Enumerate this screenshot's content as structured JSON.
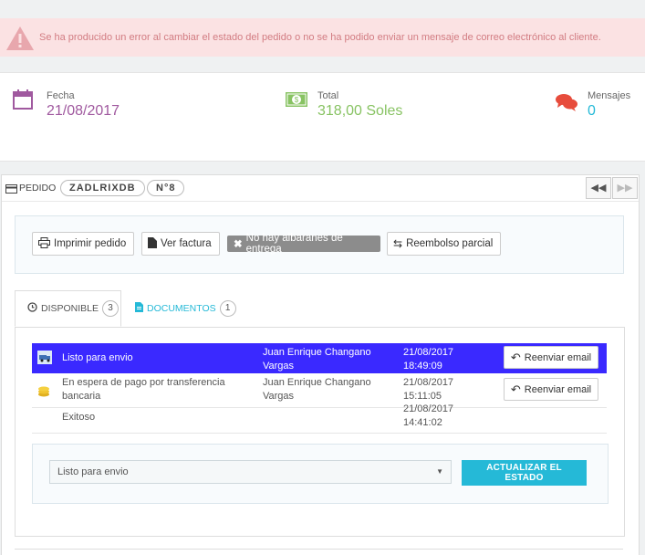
{
  "alert": {
    "message": "Se ha producido un error al cambiar el estado del pedido o no se ha podido enviar un mensaje de correo electrónico al cliente.",
    "icon": "warning-icon"
  },
  "kpis": {
    "fecha": {
      "label": "Fecha",
      "value": "21/08/2017",
      "color": "#a0599f",
      "icon": "calendar-icon"
    },
    "total": {
      "label": "Total",
      "value": "318,00 Soles",
      "color": "#88c363",
      "icon": "money-icon"
    },
    "mensajes": {
      "label": "Mensajes",
      "value": "0",
      "color": "#25b9d7",
      "icon": "chat-icon"
    }
  },
  "order": {
    "label": "PEDIDO",
    "reference": "ZADLRIXDB",
    "number": "N°8",
    "nav_prev_icon": "backward-icon",
    "nav_next_icon": "forward-icon"
  },
  "actions": {
    "print": "Imprimir pedido",
    "invoice": "Ver factura",
    "no_delivery": "No hay albaranes de entrega",
    "refund": "Reembolso parcial"
  },
  "tabs": {
    "disponible": {
      "label": "DISPONIBLE",
      "count": "3"
    },
    "documentos": {
      "label": "DOCUMENTOS",
      "count": "1"
    }
  },
  "history": [
    {
      "state": "Listo para envio",
      "employee": "Juan Enrique Changano Vargas",
      "date": "21/08/2017",
      "time": "18:49:09",
      "action": "Reenviar email",
      "icon": "truck-icon"
    },
    {
      "state": "En espera de pago por transferencia bancaria",
      "employee": "Juan Enrique Changano Vargas",
      "date": "21/08/2017",
      "time": "15:11:05",
      "action": "Reenviar email",
      "icon": "coins-icon"
    },
    {
      "state": "Exitoso",
      "employee": "",
      "date": "21/08/2017",
      "time": "14:41:02",
      "action": "",
      "icon": ""
    }
  ],
  "status_update": {
    "selected": "Listo para envio",
    "button": "ACTUALIZAR EL ESTADO"
  }
}
